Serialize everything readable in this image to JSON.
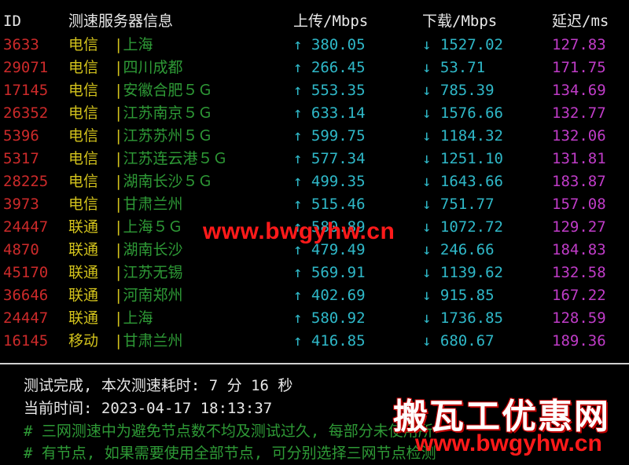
{
  "header": {
    "id": "ID",
    "server_info": "测速服务器信息",
    "upload": "上传/Mbps",
    "download": "下载/Mbps",
    "latency": "延迟/ms"
  },
  "separator": "|",
  "up_arrow": "↑",
  "down_arrow": "↓",
  "rows": [
    {
      "id": "3633",
      "isp": "电信",
      "city": "上海",
      "up": "380.05",
      "down": "1527.02",
      "lat": "127.83"
    },
    {
      "id": "29071",
      "isp": "电信",
      "city": "四川成都",
      "up": "266.45",
      "down": "53.71",
      "lat": "171.75"
    },
    {
      "id": "17145",
      "isp": "电信",
      "city": "安徽合肥５Ｇ",
      "up": "553.35",
      "down": "785.39",
      "lat": "134.69"
    },
    {
      "id": "26352",
      "isp": "电信",
      "city": "江苏南京５Ｇ",
      "up": "633.14",
      "down": "1576.66",
      "lat": "132.77"
    },
    {
      "id": "5396",
      "isp": "电信",
      "city": "江苏苏州５Ｇ",
      "up": "599.75",
      "down": "1184.32",
      "lat": "132.06"
    },
    {
      "id": "5317",
      "isp": "电信",
      "city": "江苏连云港５Ｇ",
      "up": "577.34",
      "down": "1251.10",
      "lat": "131.81"
    },
    {
      "id": "28225",
      "isp": "电信",
      "city": "湖南长沙５Ｇ",
      "up": "499.35",
      "down": "1643.66",
      "lat": "183.87"
    },
    {
      "id": "3973",
      "isp": "电信",
      "city": "甘肃兰州",
      "up": "515.46",
      "down": "751.77",
      "lat": "157.08"
    },
    {
      "id": "24447",
      "isp": "联通",
      "city": "上海５Ｇ",
      "up": "580.89",
      "down": "1072.72",
      "lat": "129.27"
    },
    {
      "id": "4870",
      "isp": "联通",
      "city": "湖南长沙",
      "up": "479.49",
      "down": "246.66",
      "lat": "184.83"
    },
    {
      "id": "45170",
      "isp": "联通",
      "city": "江苏无锡",
      "up": "569.91",
      "down": "1139.62",
      "lat": "132.58"
    },
    {
      "id": "36646",
      "isp": "联通",
      "city": "河南郑州",
      "up": "402.69",
      "down": "915.85",
      "lat": "167.22"
    },
    {
      "id": "24447",
      "isp": "联通",
      "city": "上海",
      "up": "580.92",
      "down": "1736.85",
      "lat": "128.59"
    },
    {
      "id": "16145",
      "isp": "移动",
      "city": "甘肃兰州",
      "up": "416.85",
      "down": "680.67",
      "lat": "189.36"
    }
  ],
  "footer": {
    "line1": "测试完成, 本次测速耗时: 7 分 16 秒",
    "line2": "当前时间: 2023-04-17 18:13:37",
    "line3": "# 三网测速中为避免节点数不均及测试过久, 每部分未使用所",
    "line4": "# 有节点, 如果需要使用全部节点, 可分别选择三网节点检测"
  },
  "watermarks": {
    "url_center": "www.bwgyhw.cn",
    "brand": "搬瓦工优惠网",
    "url_corner": "www.bwgyhw.cn"
  }
}
